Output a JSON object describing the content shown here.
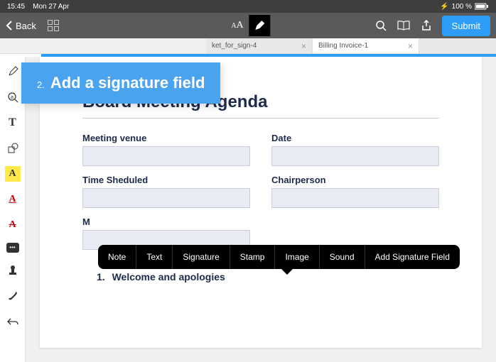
{
  "status": {
    "time": "15:45",
    "date": "Mon 27 Apr",
    "battery": "100 %",
    "charging_glyph": "⚡"
  },
  "toolbar": {
    "back_label": "Back",
    "submit_label": "Submit"
  },
  "tabs": [
    {
      "label": "ket_for_sign-4",
      "active": false
    },
    {
      "label": "Billing Invoice-1",
      "active": true
    }
  ],
  "callout": {
    "number": "2.",
    "text": "Add a signature field"
  },
  "context_menu": [
    "Note",
    "Text",
    "Signature",
    "Stamp",
    "Image",
    "Sound",
    "Add Signature Field"
  ],
  "doc": {
    "title": "Board Meeting Agenda",
    "fields": {
      "venue": "Meeting venue",
      "date": "Date",
      "time": "Time Sheduled",
      "chair": "Chairperson",
      "partial": "M"
    },
    "agenda": [
      {
        "num": "1.",
        "text": "Welcome and apologies"
      }
    ]
  },
  "tools": {
    "pencil": "pencil",
    "zoom_text": "zoom-text",
    "text_t": "T",
    "shape": "shape",
    "highlight": "A",
    "underline": "A",
    "strike": "A",
    "comment": "…",
    "stamp": "stamp",
    "brush": "brush",
    "undo": "undo"
  }
}
